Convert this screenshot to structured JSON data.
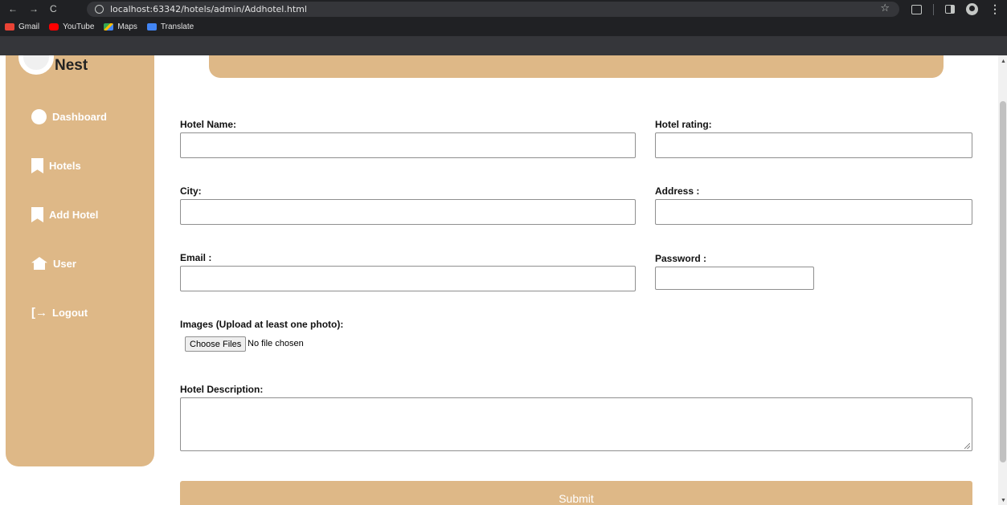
{
  "browser": {
    "url": "localhost:63342/hotels/admin/Addhotel.html",
    "bookmarks": [
      {
        "label": "Gmail",
        "icon": "gmail-icon"
      },
      {
        "label": "YouTube",
        "icon": "youtube-icon"
      },
      {
        "label": "Maps",
        "icon": "maps-icon"
      },
      {
        "label": "Translate",
        "icon": "translate-icon"
      }
    ]
  },
  "sidebar": {
    "brand": "Nest",
    "items": [
      {
        "label": "Dashboard",
        "icon": "dashboard-icon"
      },
      {
        "label": "Hotels",
        "icon": "bookmark-icon"
      },
      {
        "label": "Add Hotel",
        "icon": "bookmark-icon"
      },
      {
        "label": "User",
        "icon": "home-icon"
      },
      {
        "label": "Logout",
        "icon": "logout-icon"
      }
    ]
  },
  "form": {
    "hotel_name_label": "Hotel Name:",
    "hotel_rating_label": "Hotel rating:",
    "city_label": "City:",
    "address_label": "Address :",
    "email_label": "Email :",
    "password_label": "Password :",
    "images_label": "Images (Upload at least one photo):",
    "choose_files": "Choose Files",
    "file_status": "No file chosen",
    "description_label": "Hotel Description:",
    "submit": "Submit"
  },
  "colors": {
    "accent": "#deb887",
    "chrome": "#202124"
  }
}
